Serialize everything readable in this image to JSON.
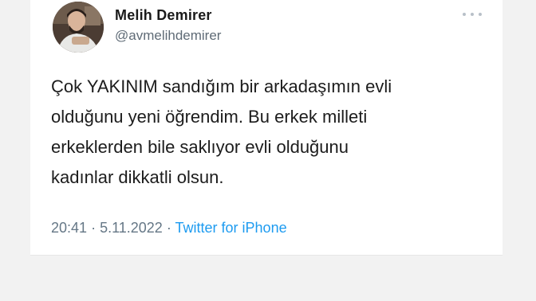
{
  "tweet": {
    "author": {
      "name": "Melih Demirer",
      "handle": "@avmelihdemirer"
    },
    "text_lines": [
      "Çok YAKINIM sandığım bir arkadaşımın evli",
      "olduğunu yeni öğrendim. Bu erkek milleti",
      "erkeklerden bile saklıyor evli olduğunu",
      "kadınlar dikkatli olsun."
    ],
    "meta": {
      "time": "20:41",
      "separator": "·",
      "date": "5.11.2022",
      "source": "Twitter for iPhone"
    },
    "more_icon": "more-dots-icon",
    "colors": {
      "link": "#1d9bf0",
      "secondary_text": "#657786",
      "background": "#f2f2f2"
    }
  }
}
